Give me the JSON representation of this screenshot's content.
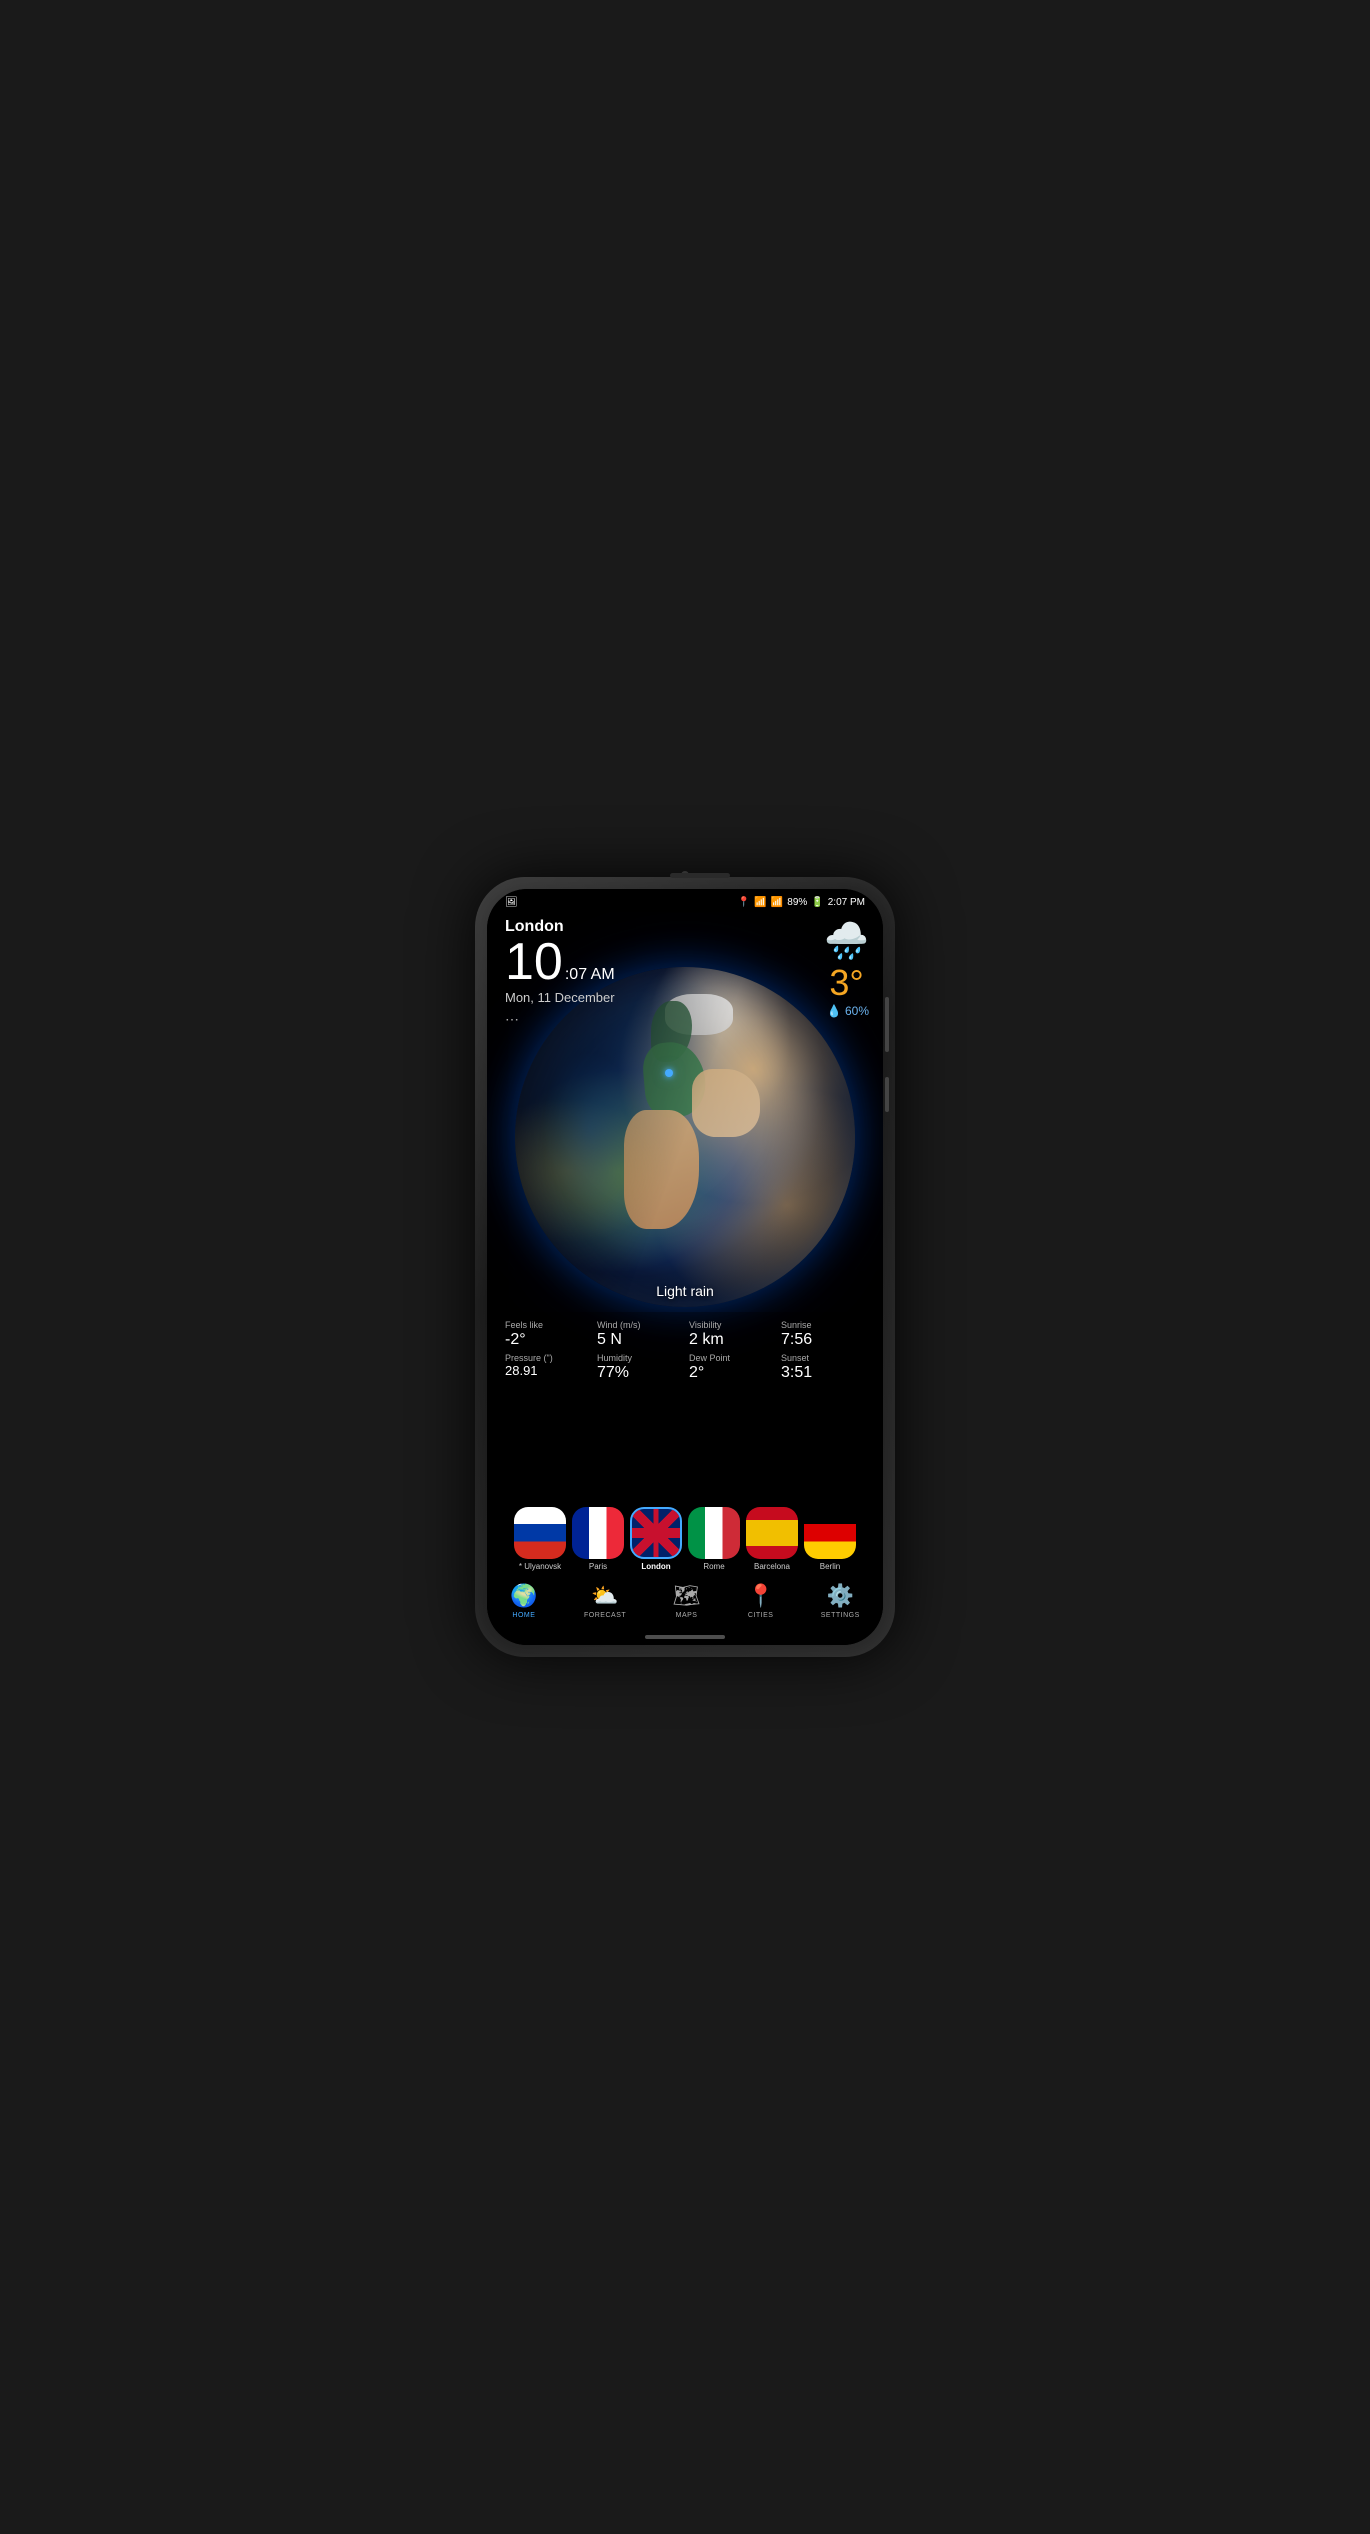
{
  "phone": {
    "statusBar": {
      "location_icon": "📍",
      "wifi_icon": "wifi",
      "signal_icon": "signal",
      "battery": "89%",
      "time": "2:07 PM"
    },
    "weatherHeader": {
      "city": "London",
      "time_large": "10",
      "time_suffix": ":07 AM",
      "date": "Mon, 11 December",
      "share_icon": "share"
    },
    "tempDisplay": {
      "cloud_icon": "🌧",
      "temperature": "3°",
      "humidity_icon": "💧",
      "humidity": "60%"
    },
    "globe": {
      "weather_description": "Light rain"
    },
    "stats": [
      {
        "label": "Feels like",
        "value": "-2°"
      },
      {
        "label": "Wind (m/s)",
        "value": "5 N"
      },
      {
        "label": "Visibility",
        "value": "2 km"
      },
      {
        "label": "Sunrise",
        "value": "7:56"
      },
      {
        "label": "Pressure (\")",
        "value": "28.91"
      },
      {
        "label": "Humidity",
        "value": "77%"
      },
      {
        "label": "Dew Point",
        "value": "2°"
      },
      {
        "label": "Sunset",
        "value": "3:51"
      }
    ],
    "cities": [
      {
        "name": "* Ulyanovsk",
        "flag": "russia",
        "selected": false
      },
      {
        "name": "Paris",
        "flag": "france",
        "selected": false
      },
      {
        "name": "London",
        "flag": "uk",
        "selected": true
      },
      {
        "name": "Rome",
        "flag": "italy",
        "selected": false
      },
      {
        "name": "Barcelona",
        "flag": "spain",
        "selected": false
      },
      {
        "name": "Berlin",
        "flag": "berlin",
        "selected": false
      }
    ],
    "navigation": [
      {
        "id": "home",
        "icon": "🌍",
        "label": "HOME",
        "active": true
      },
      {
        "id": "forecast",
        "icon": "⛅",
        "label": "FORECAST",
        "active": false
      },
      {
        "id": "maps",
        "icon": "🗺",
        "label": "MAPS",
        "active": false
      },
      {
        "id": "cities",
        "icon": "📍",
        "label": "CITIES",
        "active": false
      },
      {
        "id": "settings",
        "icon": "⚙",
        "label": "SETTINGS",
        "active": false
      }
    ]
  }
}
